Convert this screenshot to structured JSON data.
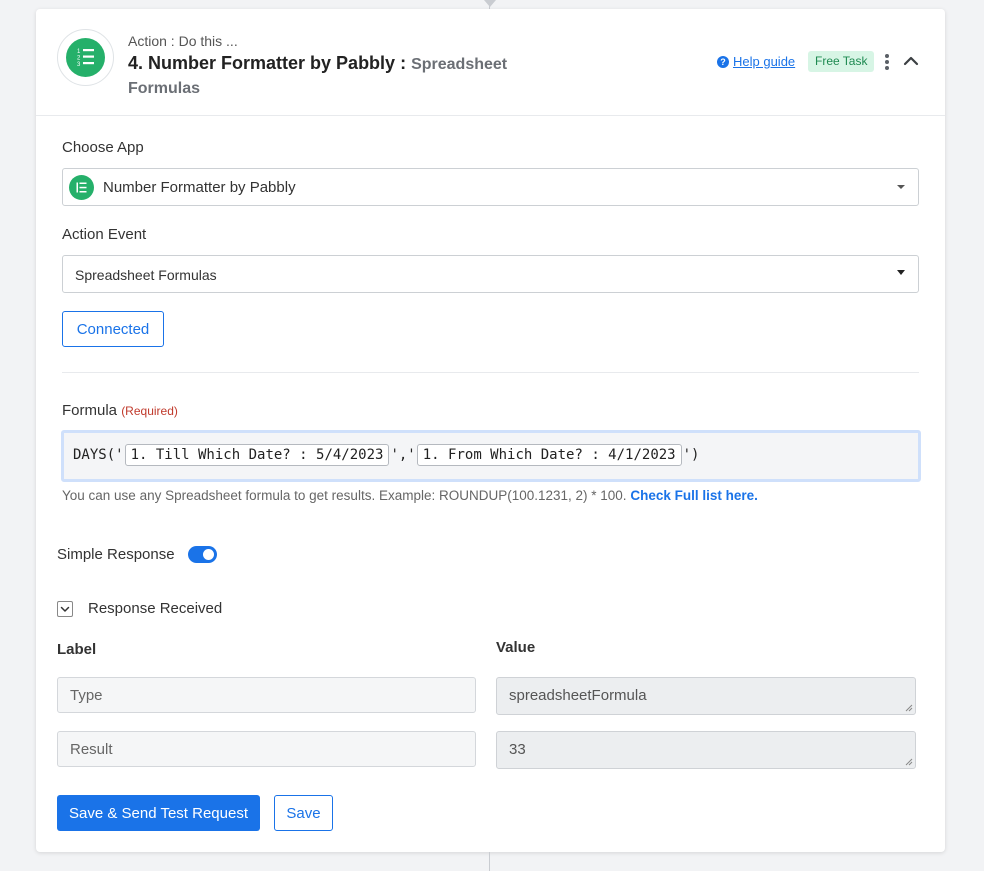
{
  "header": {
    "subtitle": "Action : Do this ...",
    "title": "4. Number Formatter by Pabbly :",
    "event": "Spreadsheet Formulas",
    "help_label": "Help guide",
    "badge": "Free Task"
  },
  "choose_app": {
    "label": "Choose App",
    "value": "Number Formatter by Pabbly"
  },
  "action_event": {
    "label": "Action Event",
    "value": "Spreadsheet Formulas"
  },
  "connected_label": "Connected",
  "formula": {
    "label": "Formula",
    "required": "(Required)",
    "prefix": "DAYS('",
    "token1": "1. Till Which Date? : 5/4/2023",
    "separator": "','",
    "token2": "1. From Which Date? : 4/1/2023",
    "suffix": "')",
    "hint": "You can use any Spreadsheet formula to get results. Example: ROUNDUP(100.1231, 2) * 100.",
    "hint_link": "Check Full list here."
  },
  "simple_response": {
    "label": "Simple Response",
    "enabled": true
  },
  "response": {
    "label": "Response Received",
    "col_label": "Label",
    "col_value": "Value",
    "rows": [
      {
        "label": "Type",
        "value": "spreadsheetFormula"
      },
      {
        "label": "Result",
        "value": "33"
      }
    ]
  },
  "buttons": {
    "save_send": "Save & Send Test Request",
    "save": "Save"
  },
  "colors": {
    "accent": "#1a73e8",
    "brand_green": "#25b06a",
    "badge_bg": "#d7f5e5",
    "required": "#c0392b"
  }
}
